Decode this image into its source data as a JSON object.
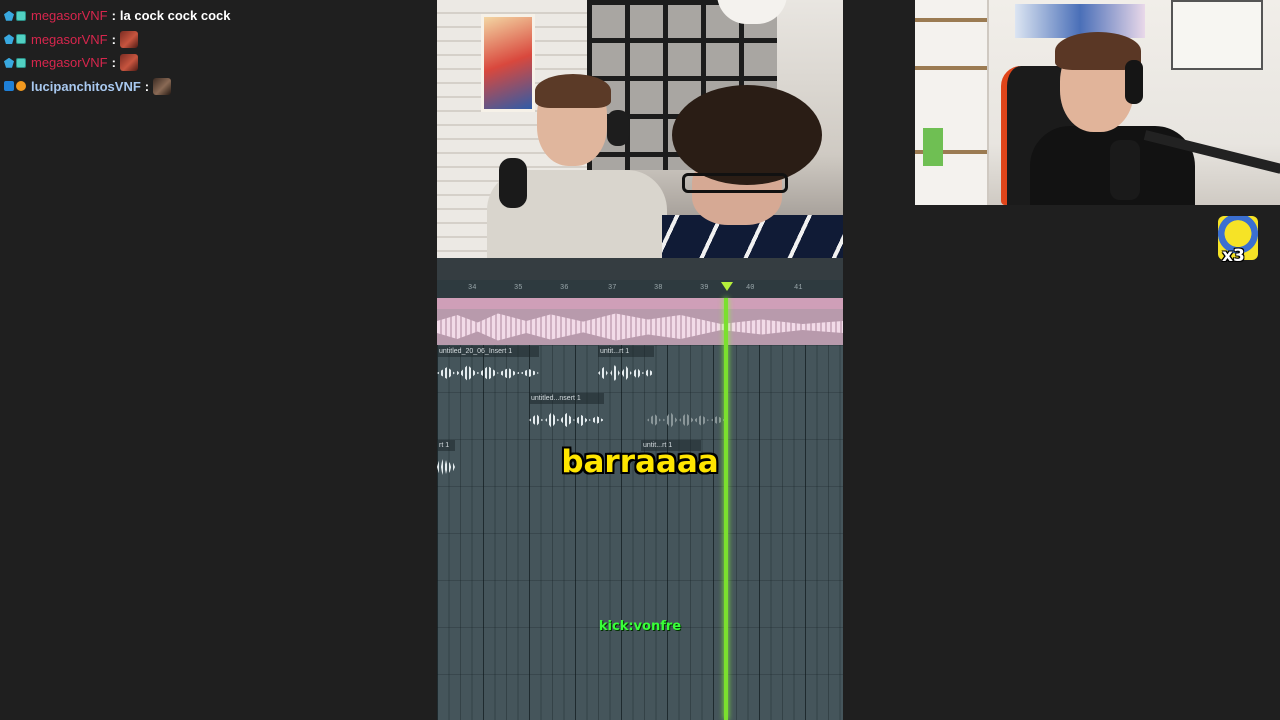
{
  "chat": {
    "messages": [
      {
        "user": "megasorVNF",
        "text": "la cock cock cock",
        "emote": null
      },
      {
        "user": "megasorVNF",
        "text": "",
        "emote": "angry-face-emote"
      },
      {
        "user": "megasorVNF",
        "text": "",
        "emote": "angry-face-emote"
      },
      {
        "user": "lucipanchitosVNF",
        "text": "",
        "emote": "face-emote"
      }
    ],
    "separator": ":"
  },
  "daw": {
    "ruler_ticks": [
      "34",
      "35",
      "36",
      "37",
      "38",
      "39",
      "40",
      "41"
    ],
    "clips": {
      "c1": "untitled_20_06_Insert 1",
      "c2": "untit...rt 1",
      "c3": "untitled...nsert 1",
      "c4": "rt 1",
      "c5": "untit...rt 1"
    },
    "playhead_color": "#7be02e",
    "master_color": "#b89aac"
  },
  "overlay": {
    "subtitle": "barraaaa",
    "watermark": "kick:vonfre",
    "subtitle_color": "#ffe600",
    "watermark_color": "#38ff38"
  },
  "emote_combo": {
    "icon": "yellow-character-emote",
    "count": "x3"
  },
  "colors": {
    "username_red": "#d7264d",
    "username_blue": "#a8c8ef",
    "background": "#1f1f1f"
  }
}
